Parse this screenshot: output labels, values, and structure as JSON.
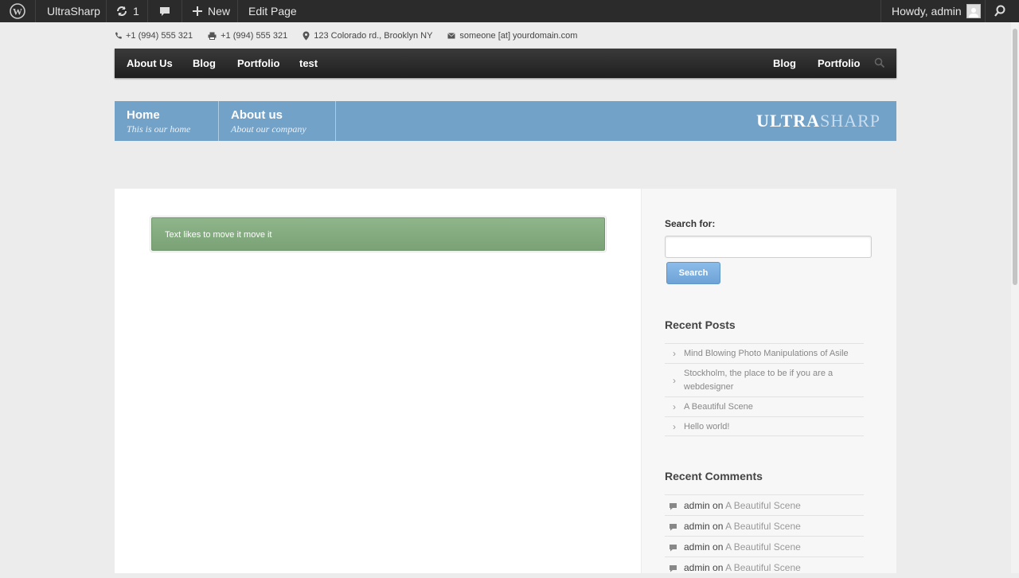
{
  "adminbar": {
    "site_name": "UltraSharp",
    "updates_count": "1",
    "new_label": "New",
    "edit_label": "Edit Page",
    "howdy": "Howdy, admin"
  },
  "contact": {
    "phone": "+1 (994) 555 321",
    "fax": "+1 (994) 555 321",
    "address": "123 Colorado rd., Brooklyn NY",
    "email": "someone [at] yourdomain.com"
  },
  "nav": {
    "left": [
      "About Us",
      "Blog",
      "Portfolio",
      "test"
    ],
    "right": [
      "Blog",
      "Portfolio"
    ]
  },
  "header": {
    "tabs": [
      {
        "title": "Home",
        "subtitle": "This is our home"
      },
      {
        "title": "About us",
        "subtitle": "About our company"
      }
    ],
    "logo_a": "ULTRA",
    "logo_b": "SHARP"
  },
  "content": {
    "notice": "Text likes to move it move it"
  },
  "sidebar": {
    "search_label": "Search for:",
    "search_button": "Search",
    "recent_posts_title": "Recent Posts",
    "recent_posts": [
      "Mind Blowing Photo Manipulations of Asile",
      "Stockholm, the place to be if you are a webdesigner",
      "A Beautiful Scene",
      "Hello world!"
    ],
    "recent_comments_title": "Recent Comments",
    "recent_comments": [
      {
        "author": "admin",
        "on": "on",
        "post": "A Beautiful Scene"
      },
      {
        "author": "admin",
        "on": "on",
        "post": "A Beautiful Scene"
      },
      {
        "author": "admin",
        "on": "on",
        "post": "A Beautiful Scene"
      },
      {
        "author": "admin",
        "on": "on",
        "post": "A Beautiful Scene"
      }
    ]
  },
  "colors": {
    "admin_bar": "#2b2b2b",
    "nav": "#262626",
    "header_blue": "#73a2c8",
    "notice_green": "#84ab80",
    "button_blue": "#7aaee0"
  }
}
